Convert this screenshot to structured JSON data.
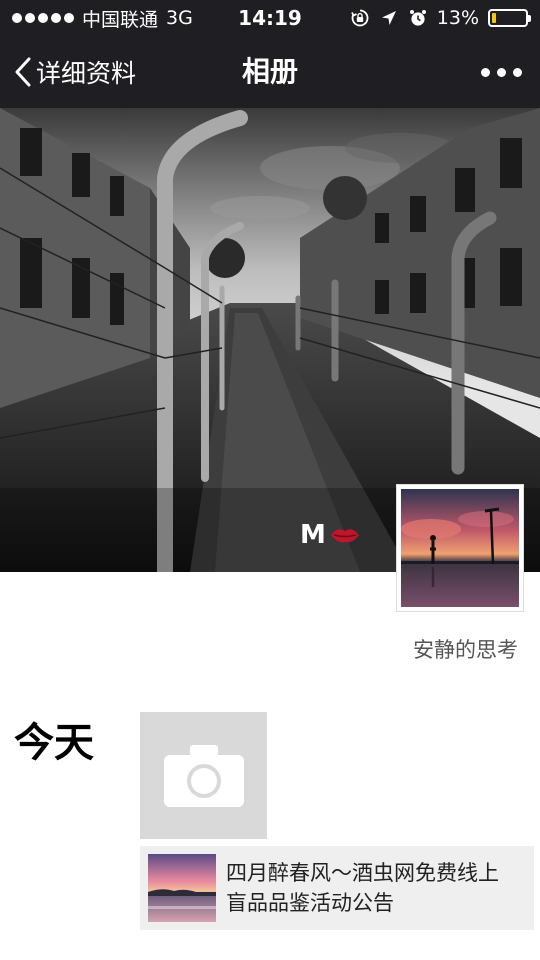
{
  "status_bar": {
    "carrier": "中国联通",
    "network": "3G",
    "time": "14:19",
    "battery_percent": "13%",
    "battery_level": 0.13,
    "icons": [
      "signal-dots",
      "lock-rotation-icon",
      "location-arrow-icon",
      "alarm-icon",
      "battery-icon"
    ]
  },
  "nav": {
    "back_label": "详细资料",
    "title": "相册",
    "more_icon": "more-dots-icon"
  },
  "cover": {
    "mark_text": "M",
    "mark_icon": "lips-icon"
  },
  "profile": {
    "nickname": "安静的思考"
  },
  "moments": {
    "day_label": "今天",
    "camera_icon": "camera-icon",
    "share": {
      "title": "四月醉春风～酒虫网免费线上盲品品鉴活动公告"
    }
  },
  "colors": {
    "bar_background": "#1f1f23",
    "battery_fill": "#f5c518",
    "tile_background": "#d9d9d9",
    "card_background": "#efefef"
  }
}
